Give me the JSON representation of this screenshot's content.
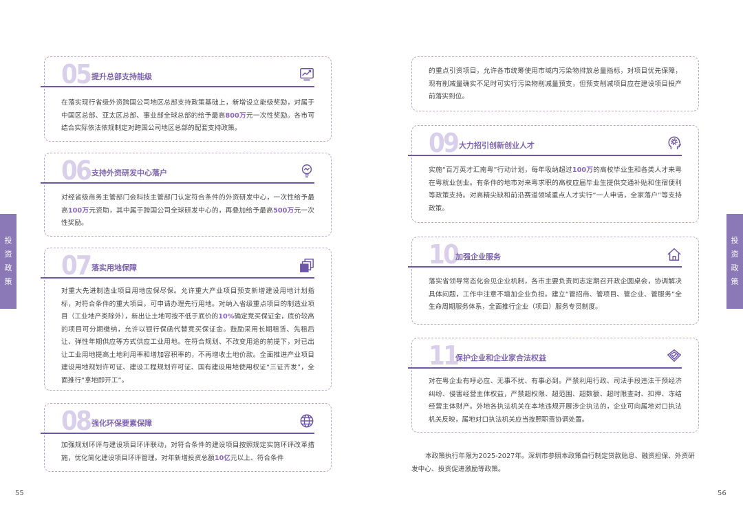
{
  "side_tab": {
    "chars": [
      "投",
      "资",
      "政",
      "策"
    ]
  },
  "pages": {
    "left": "55",
    "right": "56"
  },
  "card05": {
    "num": "05",
    "title": "提升总部支持能级",
    "icon": "trend-chart-icon",
    "t1": "在落实现行省级外资跨国公司地区总部支持政策基础上，新增设立能级奖励，对属于中国区总部、亚太区总部、事业部全球总部的给予最高",
    "h1": "800万",
    "t2": "元一次性奖励。各市可结合实际依法依规制定对跨国公司地区总部的配套支持政策。"
  },
  "card06": {
    "num": "06",
    "title": "支持外资研发中心落户",
    "icon": "lightbulb-icon",
    "t1": "对经省级商务主管部门会科技主管部门认定符合条件的外资研发中心，一次性给予最高",
    "h1": "100万",
    "t2": "元资助，其中属于跨国公司全球研发中心的，再叠加给予最高",
    "h2": "500万",
    "t3": "元一次性奖励。"
  },
  "card07": {
    "num": "07",
    "title": "落实用地保障",
    "icon": "layers-icon",
    "t1": "对重大先进制造业项目用地应保尽保。允许重大产业项目预支新增建设用地计划指标，对符合条件的重大项目，可申请办理先行用地。对纳入省级重点项目的制造业项目（工业地产类除外），新出让土地可按不低于底价的",
    "h1": "10%",
    "t2": "确定竞买保证金，底价较高的项目可分期缴纳，允许以银行保函代替竞买保证金。鼓励采用长期租赁、先租后让、弹性年期供应等方式供应工业用地。在符合规划、不改变用途的前提下，对已出让工业用地提高土地利用率和增加容积率的，不再增收土地价款。全面推进产业项目建设用地规划许可证、建设工程规划许可证、国有建设用地使用权证“三证齐发”，全面推行“拿地即开工”。"
  },
  "card08": {
    "num": "08",
    "title": "强化环保要素保障",
    "icon": "globe-icon",
    "t1": "加强规划环评与建设项目环评联动，对符合条件的建设项目按照规定实施环评改革措施，优化简化建设项目环评管理。对年新增投资总额",
    "h1": "10亿",
    "t2": "元以上、符合条件"
  },
  "card08c": {
    "t1": "的重点引资项目，允许各市统筹使用市域内污染物排放总量指标，对项目优先保障，现有削减量确实不足时可实行污染物削减量预支，但预支削减项目应在建设项目投产前落实到位。"
  },
  "card09": {
    "num": "09",
    "title": "大力招引创新创业人才",
    "icon": "head-gear-icon",
    "t1": "实施“百万英才汇南粤”行动计划，每年吸纳超过",
    "h1": "100万",
    "t2": "的高校毕业生和各类人才来粤在粤就业创业。有条件的地市对来粤求职的高校应届毕业生提供交通补贴和住宿便利等政策支持。对高精尖缺和前沿赛道领域重点人才实行“一人申请，全家落户”等支持政策。"
  },
  "card10": {
    "num": "10",
    "title": "加强企业服务",
    "icon": "home-icon",
    "t1": "落实省领导常态化会见企业机制，各市主要负责同志定期召开政企圆桌会，协调解决具体问题，工作中注意不增加企业负担。建立“管招商、管项目、管企业、管服务”全生命周期服务体系，全面推行企业（项目）服务专员制度。"
  },
  "card11": {
    "num": "11",
    "title": "保护企业和企业家合法权益",
    "icon": "shield-check-icon",
    "t1": "对在粤企业有呼必应、无事不扰、有事必到。严禁利用行政、司法手段违法干预经济纠纷、侵害经营主体权益，严禁超权限、超范围、超数额、超时限查封、扣押、冻结经营主体财产。外地各执法机关在本地违规开展涉企执法的，企业可向属地对口执法机关反映，属地对口执法机关应当按照职责协调处置。"
  },
  "closing_note": "本政策执行年限为2025-2027年。深圳市参照本政策自行制定贷款贴息、融资担保、外资研发中心、投资促进激励等政策。",
  "colors": {
    "accent": "#6e56a6",
    "tab": "#8b79b7",
    "highlight": "#8a67c0",
    "number": "#d9cfeb"
  }
}
